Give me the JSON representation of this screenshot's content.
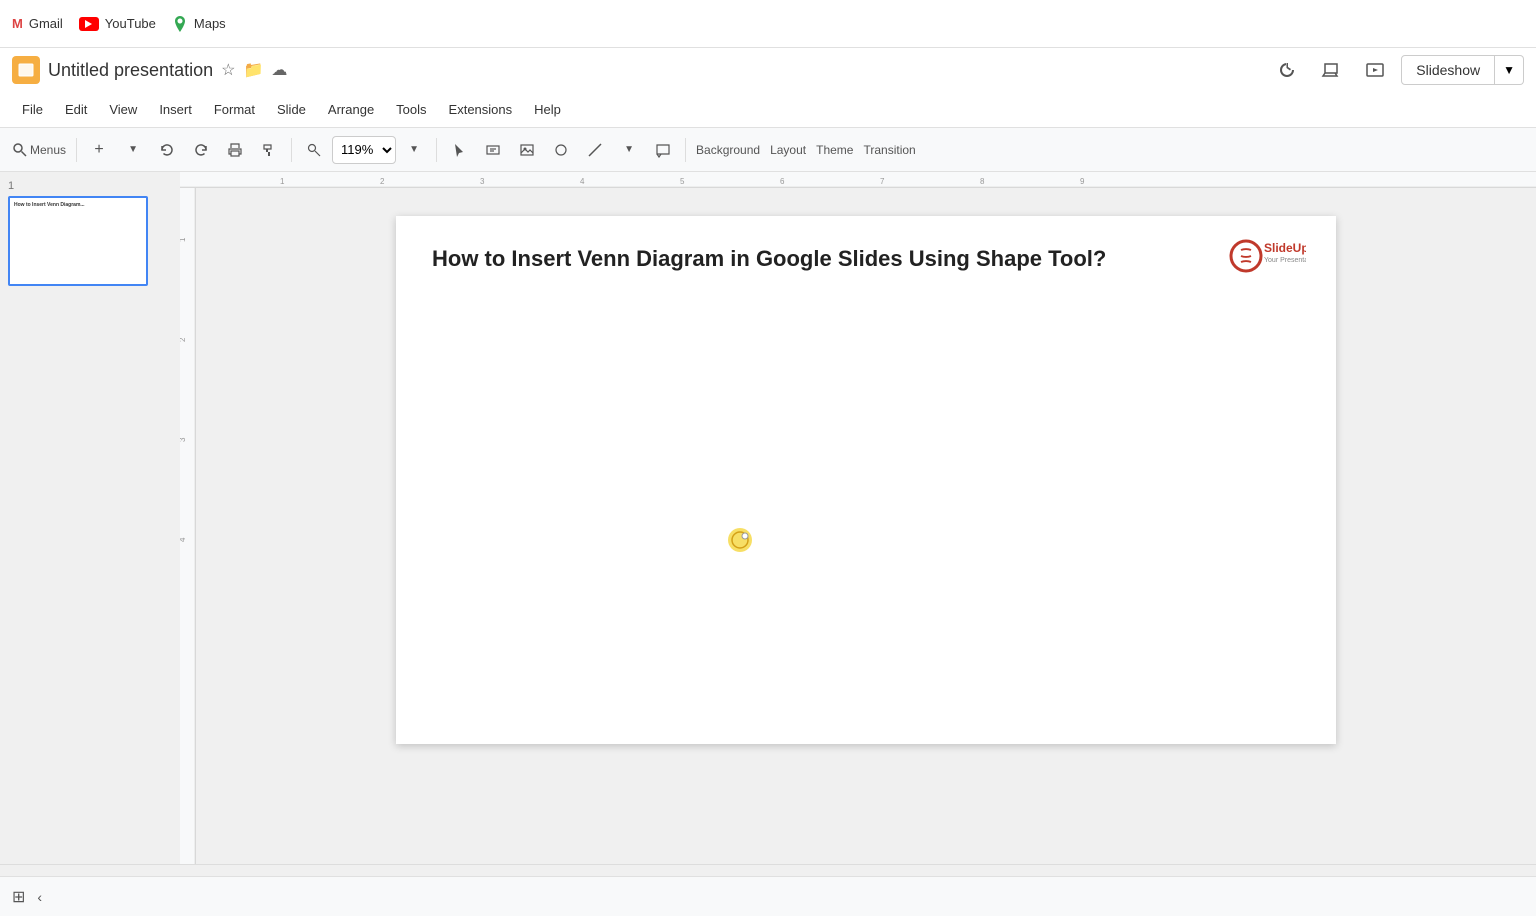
{
  "topbar": {
    "gmail_label": "Gmail",
    "youtube_label": "YouTube",
    "maps_label": "Maps"
  },
  "titlebar": {
    "presentation_title": "Untitled presentation"
  },
  "header": {
    "slideshow_label": "Slideshow"
  },
  "menubar": {
    "items": [
      "File",
      "Edit",
      "View",
      "Insert",
      "Format",
      "Slide",
      "Arrange",
      "Tools",
      "Extensions",
      "Help"
    ]
  },
  "toolbar": {
    "menus_label": "Menus",
    "zoom_value": "119%",
    "background_label": "Background",
    "layout_label": "Layout",
    "theme_label": "Theme",
    "transition_label": "Transition"
  },
  "slide": {
    "number": "1",
    "title": "How to Insert Venn Diagram in Google Slides Using Shape Tool?",
    "logo_name": "SlideUpLift",
    "logo_sub": "Your Presentation Partner"
  },
  "bottombar": {}
}
